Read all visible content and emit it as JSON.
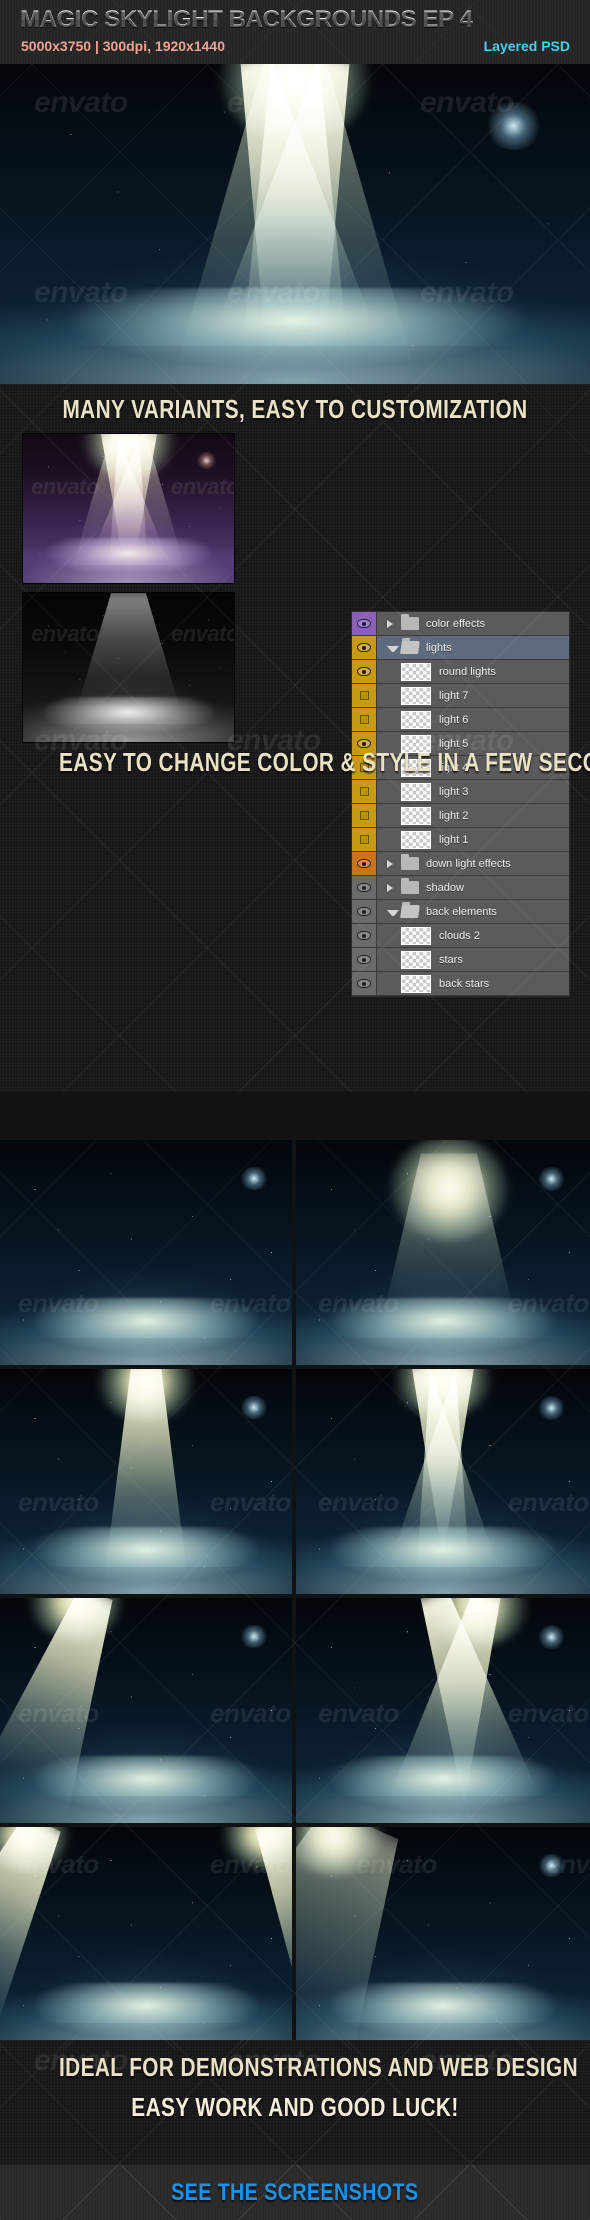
{
  "header": {
    "title": "MAGIC SKYLIGHT BACKGROUNDS EP 4",
    "spec": "5000x3750 | 300dpi, 1920x1440",
    "format": "Layered PSD",
    "title_color": "#e9e9e9",
    "spec_color": "#f0a394",
    "format_color": "#3fd2f2"
  },
  "sections": {
    "customize_heading": "MANY VARIANTS, EASY TO CUSTOMIZATION",
    "color_heading": "EASY TO CHANGE COLOR & STYLE IN A FEW SECONDS",
    "ideal_heading": "IDEAL FOR DEMONSTRATIONS AND WEB DESIGN",
    "goodluck_heading": "EASY WORK AND GOOD LUCK!",
    "heading_color": "#e9e2c4"
  },
  "cta": {
    "label": "SEE THE SCREENSHOTS",
    "color": "#1b92e8"
  },
  "watermark": {
    "text": "envato"
  },
  "layers_panel": {
    "rows": [
      {
        "name": "color effects",
        "type": "group",
        "visible": true,
        "swatch": "purple",
        "expanded": false,
        "depth": 0,
        "selected": false
      },
      {
        "name": "lights",
        "type": "group",
        "visible": true,
        "swatch": "gold",
        "expanded": true,
        "depth": 0,
        "selected": true
      },
      {
        "name": "round lights",
        "type": "layer",
        "visible": true,
        "swatch": "gold",
        "expanded": false,
        "depth": 1,
        "selected": false
      },
      {
        "name": "light 7",
        "type": "layer",
        "visible": false,
        "swatch": "gold",
        "expanded": false,
        "depth": 1,
        "selected": false
      },
      {
        "name": "light 6",
        "type": "layer",
        "visible": false,
        "swatch": "gold",
        "expanded": false,
        "depth": 1,
        "selected": false
      },
      {
        "name": "light 5",
        "type": "layer",
        "visible": true,
        "swatch": "gold",
        "expanded": false,
        "depth": 1,
        "selected": false
      },
      {
        "name": "light 4",
        "type": "layer",
        "visible": false,
        "swatch": "gold",
        "expanded": false,
        "depth": 1,
        "selected": false
      },
      {
        "name": "light 3",
        "type": "layer",
        "visible": false,
        "swatch": "gold",
        "expanded": false,
        "depth": 1,
        "selected": false
      },
      {
        "name": "light 2",
        "type": "layer",
        "visible": false,
        "swatch": "gold",
        "expanded": false,
        "depth": 1,
        "selected": false
      },
      {
        "name": "light 1",
        "type": "layer",
        "visible": false,
        "swatch": "gold",
        "expanded": false,
        "depth": 1,
        "selected": false
      },
      {
        "name": "down light effects",
        "type": "group",
        "visible": true,
        "swatch": "orange",
        "expanded": false,
        "depth": 0,
        "selected": false
      },
      {
        "name": "shadow",
        "type": "group",
        "visible": true,
        "swatch": "grey",
        "expanded": false,
        "depth": 0,
        "selected": false
      },
      {
        "name": "back elements",
        "type": "group",
        "visible": true,
        "swatch": "grey",
        "expanded": true,
        "depth": 0,
        "selected": false
      },
      {
        "name": "clouds 2",
        "type": "layer",
        "visible": true,
        "swatch": "grey",
        "expanded": false,
        "depth": 1,
        "selected": false
      },
      {
        "name": "stars",
        "type": "layer",
        "visible": true,
        "swatch": "grey",
        "expanded": false,
        "depth": 1,
        "selected": false
      },
      {
        "name": "back stars",
        "type": "layer",
        "visible": true,
        "swatch": "grey",
        "expanded": false,
        "depth": 1,
        "selected": false
      }
    ],
    "swatch_colors": {
      "purple": "#8a5fb8",
      "gold": "#c79a13",
      "orange": "#c9761b",
      "grey": "#6a6a6a"
    }
  },
  "variant_previews": [
    {
      "id": "variant-purple",
      "style": "purple-violet spotlight"
    },
    {
      "id": "variant-mono",
      "style": "black and white smoke"
    }
  ],
  "variant_grid": [
    {
      "id": "grid-1",
      "beams": "no beam, blue haze only"
    },
    {
      "id": "grid-2",
      "beams": "single wide soft orb beam, centered"
    },
    {
      "id": "grid-3",
      "beams": "single tall narrow beam, centered"
    },
    {
      "id": "grid-4",
      "beams": "three converging beams, centered"
    },
    {
      "id": "grid-5",
      "beams": "single angled beam from upper left"
    },
    {
      "id": "grid-6",
      "beams": "two beams crossing"
    },
    {
      "id": "grid-7",
      "beams": "two corner beams, left and right"
    },
    {
      "id": "grid-8",
      "beams": "wide angled beam from upper left"
    }
  ]
}
